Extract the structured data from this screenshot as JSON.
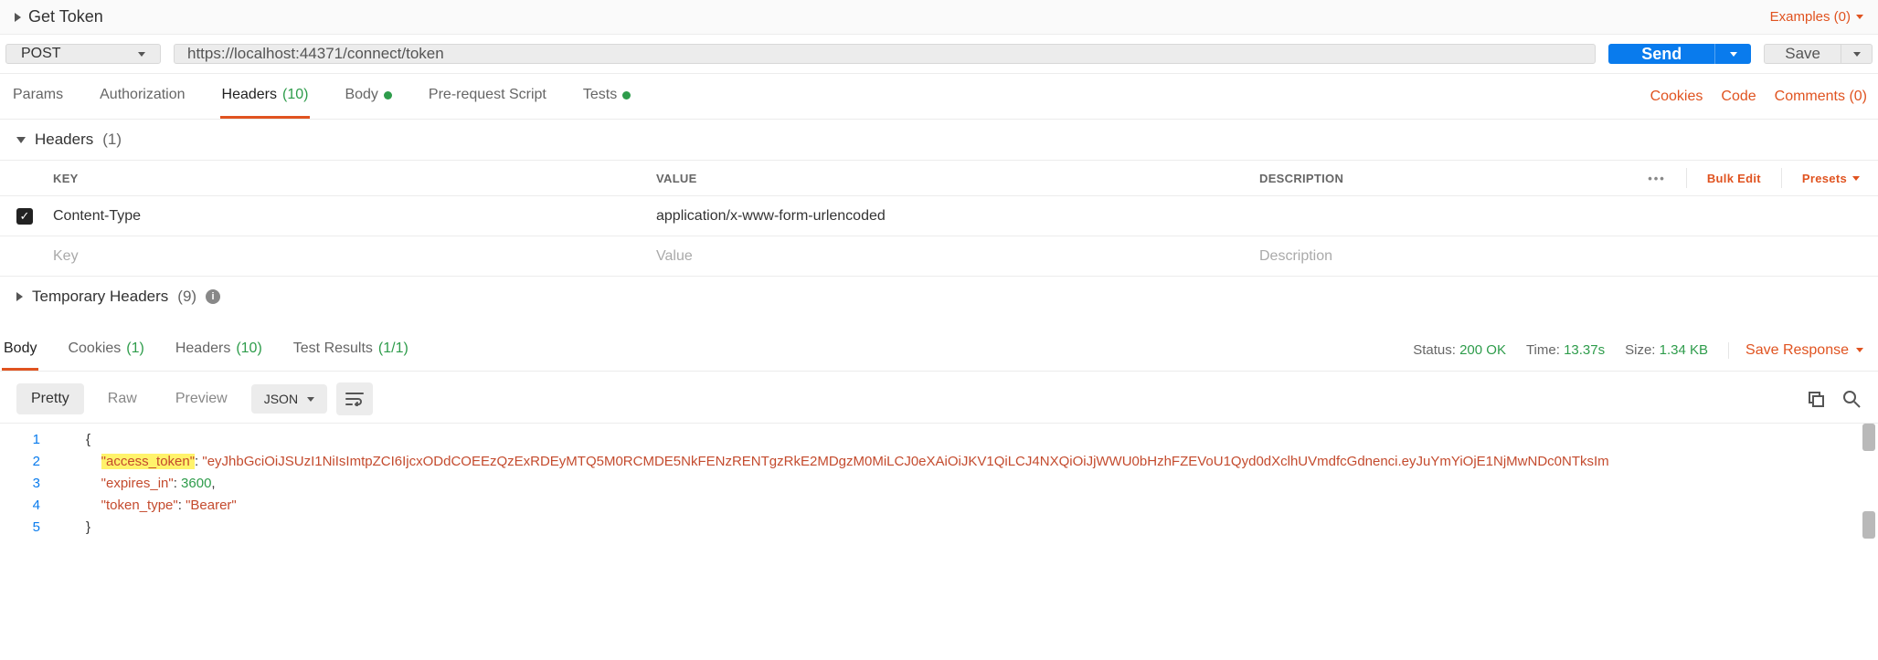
{
  "request": {
    "name": "Get Token",
    "examples_label": "Examples (0)",
    "method": "POST",
    "url": "https://localhost:44371/connect/token",
    "send_label": "Send",
    "save_label": "Save"
  },
  "req_tabs": {
    "params": "Params",
    "authorization": "Authorization",
    "headers": "Headers",
    "headers_count": "(10)",
    "body": "Body",
    "prerequest": "Pre-request Script",
    "tests": "Tests"
  },
  "req_tab_links": {
    "cookies": "Cookies",
    "code": "Code",
    "comments": "Comments (0)"
  },
  "headers_section": {
    "title": "Headers",
    "count": "(1)",
    "col_key": "KEY",
    "col_value": "VALUE",
    "col_desc": "DESCRIPTION",
    "bulk_edit": "Bulk Edit",
    "presets": "Presets",
    "rows": [
      {
        "key": "Content-Type",
        "value": "application/x-www-form-urlencoded",
        "desc": ""
      }
    ],
    "ph_key": "Key",
    "ph_value": "Value",
    "ph_desc": "Description"
  },
  "temp_headers": {
    "title": "Temporary Headers",
    "count": "(9)"
  },
  "resp_tabs": {
    "body": "Body",
    "cookies": "Cookies",
    "cookies_count": "(1)",
    "headers": "Headers",
    "headers_count": "(10)",
    "tests": "Test Results",
    "tests_count": "(1/1)"
  },
  "status": {
    "status_label": "Status:",
    "status_value": "200 OK",
    "time_label": "Time:",
    "time_value": "13.37s",
    "size_label": "Size:",
    "size_value": "1.34 KB",
    "save_response": "Save Response"
  },
  "body_toolbar": {
    "pretty": "Pretty",
    "raw": "Raw",
    "preview": "Preview",
    "type": "JSON"
  },
  "response_body": {
    "lines": [
      "1",
      "2",
      "3",
      "4",
      "5"
    ],
    "access_token_key": "\"access_token\"",
    "access_token_val": "\"eyJhbGciOiJSUzI1NiIsImtpZCI6IjcxODdCOEEzQzExRDEyMTQ5M0RCMDE5NkFENzRENTgzRkE2MDgzM0MiLCJ0eXAiOiJKV1QiLCJ4NXQiOiJjWWU0bHzhFZEVoU1Qyd0dXclhUVmdfcGdnenci.eyJuYmYiOjE1NjMwNDc0NTksIm",
    "expires_key": "\"expires_in\"",
    "expires_val": "3600",
    "token_type_key": "\"token_type\"",
    "token_type_val": "\"Bearer\""
  }
}
